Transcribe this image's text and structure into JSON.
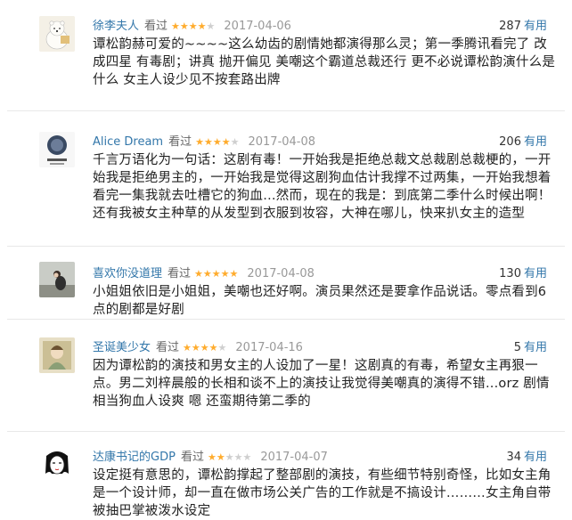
{
  "reviews": [
    {
      "user": "徐李夫人",
      "watched": "看过",
      "rating": 4,
      "date": "2017-04-06",
      "votes": "287",
      "votes_label": "有用",
      "avatar": "polar-bear-avatar",
      "content": "谭松韵赫可爱的~~~~这么幼齿的剧情她都演得那么灵；第一季腾讯看完了 改成四星 有毒剧；讲真 抛开偏见 美嘲这个霸道总裁还行 更不必说谭松韵演什么是什么 女主人设少见不按套路出牌"
    },
    {
      "user": "Alice Dream",
      "watched": "看过",
      "rating": 4,
      "date": "2017-04-08",
      "votes": "206",
      "votes_label": "有用",
      "avatar": "book-cover-avatar",
      "content": "千言万语化为一句话：这剧有毒！一开始我是拒绝总裁文总裁剧总裁梗的，一开始我是拒绝男主的，一开始我是觉得这剧狗血估计我撑不过两集，一开始我想着看完一集我就去吐槽它的狗血…然而，现在的我是：到底第二季什么时候出啊！还有我被女主种草的从发型到衣服到妆容，大神在哪儿，快来扒女主的造型"
    },
    {
      "user": "喜欢你没道理",
      "watched": "看过",
      "rating": 5,
      "date": "2017-04-08",
      "votes": "130",
      "votes_label": "有用",
      "avatar": "girl-sitting-avatar",
      "content": "小姐姐依旧是小姐姐，美嘲也还好啊。演员果然还是要拿作品说话。零点看到6点的剧都是好剧"
    },
    {
      "user": "圣诞美少女",
      "watched": "看过",
      "rating": 4,
      "date": "2017-04-16",
      "votes": "5",
      "votes_label": "有用",
      "avatar": "painting-avatar",
      "content": "因为谭松韵的演技和男女主的人设加了一星！这剧真的有毒，希望女主再狠一点。男二刘梓晨般的长相和谈不上的演技让我觉得美嘲真的演得不错...orz 剧情相当狗血人设爽 嗯 还蛮期待第二季的"
    },
    {
      "user": "达康书记的GDP",
      "watched": "看过",
      "rating": 2,
      "date": "2017-04-07",
      "votes": "34",
      "votes_label": "有用",
      "avatar": "sketch-face-avatar",
      "content": "设定挺有意思的，谭松韵撑起了整部剧的演技，有些细节特别奇怪，比如女主角是一个设计师，却一直在做市场公关广告的工作就是不搞设计………女主角自带被抽巴掌被泼水设定"
    }
  ]
}
